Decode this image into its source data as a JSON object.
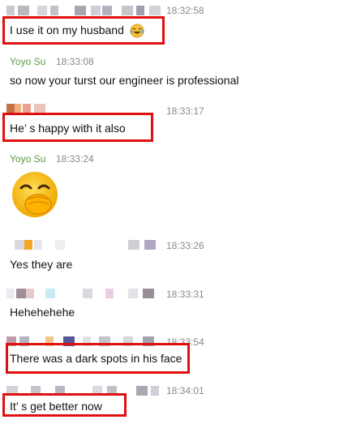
{
  "colors": {
    "sender_name": "#5a9a3e",
    "timestamp": "#8a8a8a",
    "highlight_box": "#e01010"
  },
  "messages": [
    {
      "id": "m1",
      "sender": "",
      "time": "18:32:58",
      "text": "I use it on my husband",
      "trailing_icon": "tears-of-joy-emoji",
      "highlighted": true
    },
    {
      "id": "m2",
      "sender": "Yoyo Su",
      "time": "18:33:08",
      "text": "so now your turst our engineer is professional",
      "highlighted": false
    },
    {
      "id": "m3",
      "sender": "",
      "time": "18:33:17",
      "text": "He’ s happy with it also",
      "highlighted": true
    },
    {
      "id": "m4",
      "sender": "Yoyo Su",
      "time": "18:33:24",
      "text": "",
      "icon": "covering-mouth-laughing-emoji",
      "highlighted": false
    },
    {
      "id": "m5",
      "sender": "",
      "time": "18:33:26",
      "text": "Yes they are",
      "highlighted": false
    },
    {
      "id": "m6",
      "sender": "",
      "time": "18:33:31",
      "text": "Hehehehehe",
      "highlighted": false
    },
    {
      "id": "m7",
      "sender": "",
      "time": "18:33:54",
      "text": "There was a dark spots in his face",
      "highlighted": true
    },
    {
      "id": "m8",
      "sender": "",
      "time": "18:34:01",
      "text": "It’ s get better now",
      "highlighted": true
    }
  ]
}
